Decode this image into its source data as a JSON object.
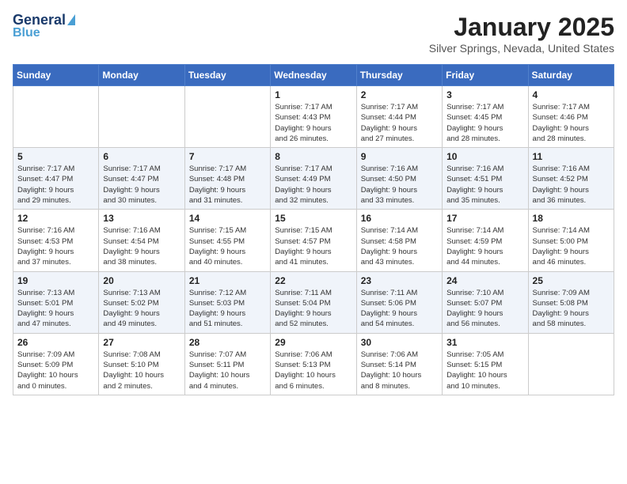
{
  "header": {
    "logo_line1": "General",
    "logo_line2": "Blue",
    "month": "January 2025",
    "location": "Silver Springs, Nevada, United States"
  },
  "weekdays": [
    "Sunday",
    "Monday",
    "Tuesday",
    "Wednesday",
    "Thursday",
    "Friday",
    "Saturday"
  ],
  "weeks": [
    [
      {
        "day": "",
        "info": ""
      },
      {
        "day": "",
        "info": ""
      },
      {
        "day": "",
        "info": ""
      },
      {
        "day": "1",
        "info": "Sunrise: 7:17 AM\nSunset: 4:43 PM\nDaylight: 9 hours\nand 26 minutes."
      },
      {
        "day": "2",
        "info": "Sunrise: 7:17 AM\nSunset: 4:44 PM\nDaylight: 9 hours\nand 27 minutes."
      },
      {
        "day": "3",
        "info": "Sunrise: 7:17 AM\nSunset: 4:45 PM\nDaylight: 9 hours\nand 28 minutes."
      },
      {
        "day": "4",
        "info": "Sunrise: 7:17 AM\nSunset: 4:46 PM\nDaylight: 9 hours\nand 28 minutes."
      }
    ],
    [
      {
        "day": "5",
        "info": "Sunrise: 7:17 AM\nSunset: 4:47 PM\nDaylight: 9 hours\nand 29 minutes."
      },
      {
        "day": "6",
        "info": "Sunrise: 7:17 AM\nSunset: 4:47 PM\nDaylight: 9 hours\nand 30 minutes."
      },
      {
        "day": "7",
        "info": "Sunrise: 7:17 AM\nSunset: 4:48 PM\nDaylight: 9 hours\nand 31 minutes."
      },
      {
        "day": "8",
        "info": "Sunrise: 7:17 AM\nSunset: 4:49 PM\nDaylight: 9 hours\nand 32 minutes."
      },
      {
        "day": "9",
        "info": "Sunrise: 7:16 AM\nSunset: 4:50 PM\nDaylight: 9 hours\nand 33 minutes."
      },
      {
        "day": "10",
        "info": "Sunrise: 7:16 AM\nSunset: 4:51 PM\nDaylight: 9 hours\nand 35 minutes."
      },
      {
        "day": "11",
        "info": "Sunrise: 7:16 AM\nSunset: 4:52 PM\nDaylight: 9 hours\nand 36 minutes."
      }
    ],
    [
      {
        "day": "12",
        "info": "Sunrise: 7:16 AM\nSunset: 4:53 PM\nDaylight: 9 hours\nand 37 minutes."
      },
      {
        "day": "13",
        "info": "Sunrise: 7:16 AM\nSunset: 4:54 PM\nDaylight: 9 hours\nand 38 minutes."
      },
      {
        "day": "14",
        "info": "Sunrise: 7:15 AM\nSunset: 4:55 PM\nDaylight: 9 hours\nand 40 minutes."
      },
      {
        "day": "15",
        "info": "Sunrise: 7:15 AM\nSunset: 4:57 PM\nDaylight: 9 hours\nand 41 minutes."
      },
      {
        "day": "16",
        "info": "Sunrise: 7:14 AM\nSunset: 4:58 PM\nDaylight: 9 hours\nand 43 minutes."
      },
      {
        "day": "17",
        "info": "Sunrise: 7:14 AM\nSunset: 4:59 PM\nDaylight: 9 hours\nand 44 minutes."
      },
      {
        "day": "18",
        "info": "Sunrise: 7:14 AM\nSunset: 5:00 PM\nDaylight: 9 hours\nand 46 minutes."
      }
    ],
    [
      {
        "day": "19",
        "info": "Sunrise: 7:13 AM\nSunset: 5:01 PM\nDaylight: 9 hours\nand 47 minutes."
      },
      {
        "day": "20",
        "info": "Sunrise: 7:13 AM\nSunset: 5:02 PM\nDaylight: 9 hours\nand 49 minutes."
      },
      {
        "day": "21",
        "info": "Sunrise: 7:12 AM\nSunset: 5:03 PM\nDaylight: 9 hours\nand 51 minutes."
      },
      {
        "day": "22",
        "info": "Sunrise: 7:11 AM\nSunset: 5:04 PM\nDaylight: 9 hours\nand 52 minutes."
      },
      {
        "day": "23",
        "info": "Sunrise: 7:11 AM\nSunset: 5:06 PM\nDaylight: 9 hours\nand 54 minutes."
      },
      {
        "day": "24",
        "info": "Sunrise: 7:10 AM\nSunset: 5:07 PM\nDaylight: 9 hours\nand 56 minutes."
      },
      {
        "day": "25",
        "info": "Sunrise: 7:09 AM\nSunset: 5:08 PM\nDaylight: 9 hours\nand 58 minutes."
      }
    ],
    [
      {
        "day": "26",
        "info": "Sunrise: 7:09 AM\nSunset: 5:09 PM\nDaylight: 10 hours\nand 0 minutes."
      },
      {
        "day": "27",
        "info": "Sunrise: 7:08 AM\nSunset: 5:10 PM\nDaylight: 10 hours\nand 2 minutes."
      },
      {
        "day": "28",
        "info": "Sunrise: 7:07 AM\nSunset: 5:11 PM\nDaylight: 10 hours\nand 4 minutes."
      },
      {
        "day": "29",
        "info": "Sunrise: 7:06 AM\nSunset: 5:13 PM\nDaylight: 10 hours\nand 6 minutes."
      },
      {
        "day": "30",
        "info": "Sunrise: 7:06 AM\nSunset: 5:14 PM\nDaylight: 10 hours\nand 8 minutes."
      },
      {
        "day": "31",
        "info": "Sunrise: 7:05 AM\nSunset: 5:15 PM\nDaylight: 10 hours\nand 10 minutes."
      },
      {
        "day": "",
        "info": ""
      }
    ]
  ]
}
